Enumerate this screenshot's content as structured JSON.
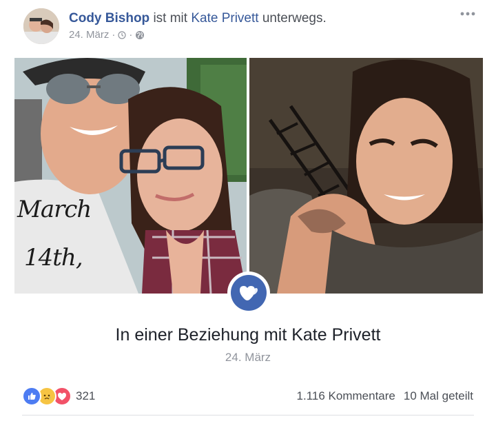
{
  "post": {
    "author": "Cody Bishop",
    "connector": " ist mit ",
    "tagged": "Kate Privett",
    "suffix": " unterwegs.",
    "date": "24. März",
    "separator": "·"
  },
  "photos": {
    "handwriting_line1": "March",
    "handwriting_line2": "14th,"
  },
  "event": {
    "title": "In einer Beziehung mit Kate Privett",
    "date": "24. März",
    "icon": "heart-icon",
    "accent": "#4267b2"
  },
  "footer": {
    "reaction_icons": [
      "like-icon",
      "sad-icon",
      "love-icon"
    ],
    "reaction_count": "321",
    "comments": "1.116 Kommentare",
    "shares": "10 Mal geteilt"
  },
  "colors": {
    "link": "#365899",
    "meta": "#90949c",
    "like": "#4d7cf2",
    "sad": "#f6c443",
    "love": "#f25268"
  }
}
